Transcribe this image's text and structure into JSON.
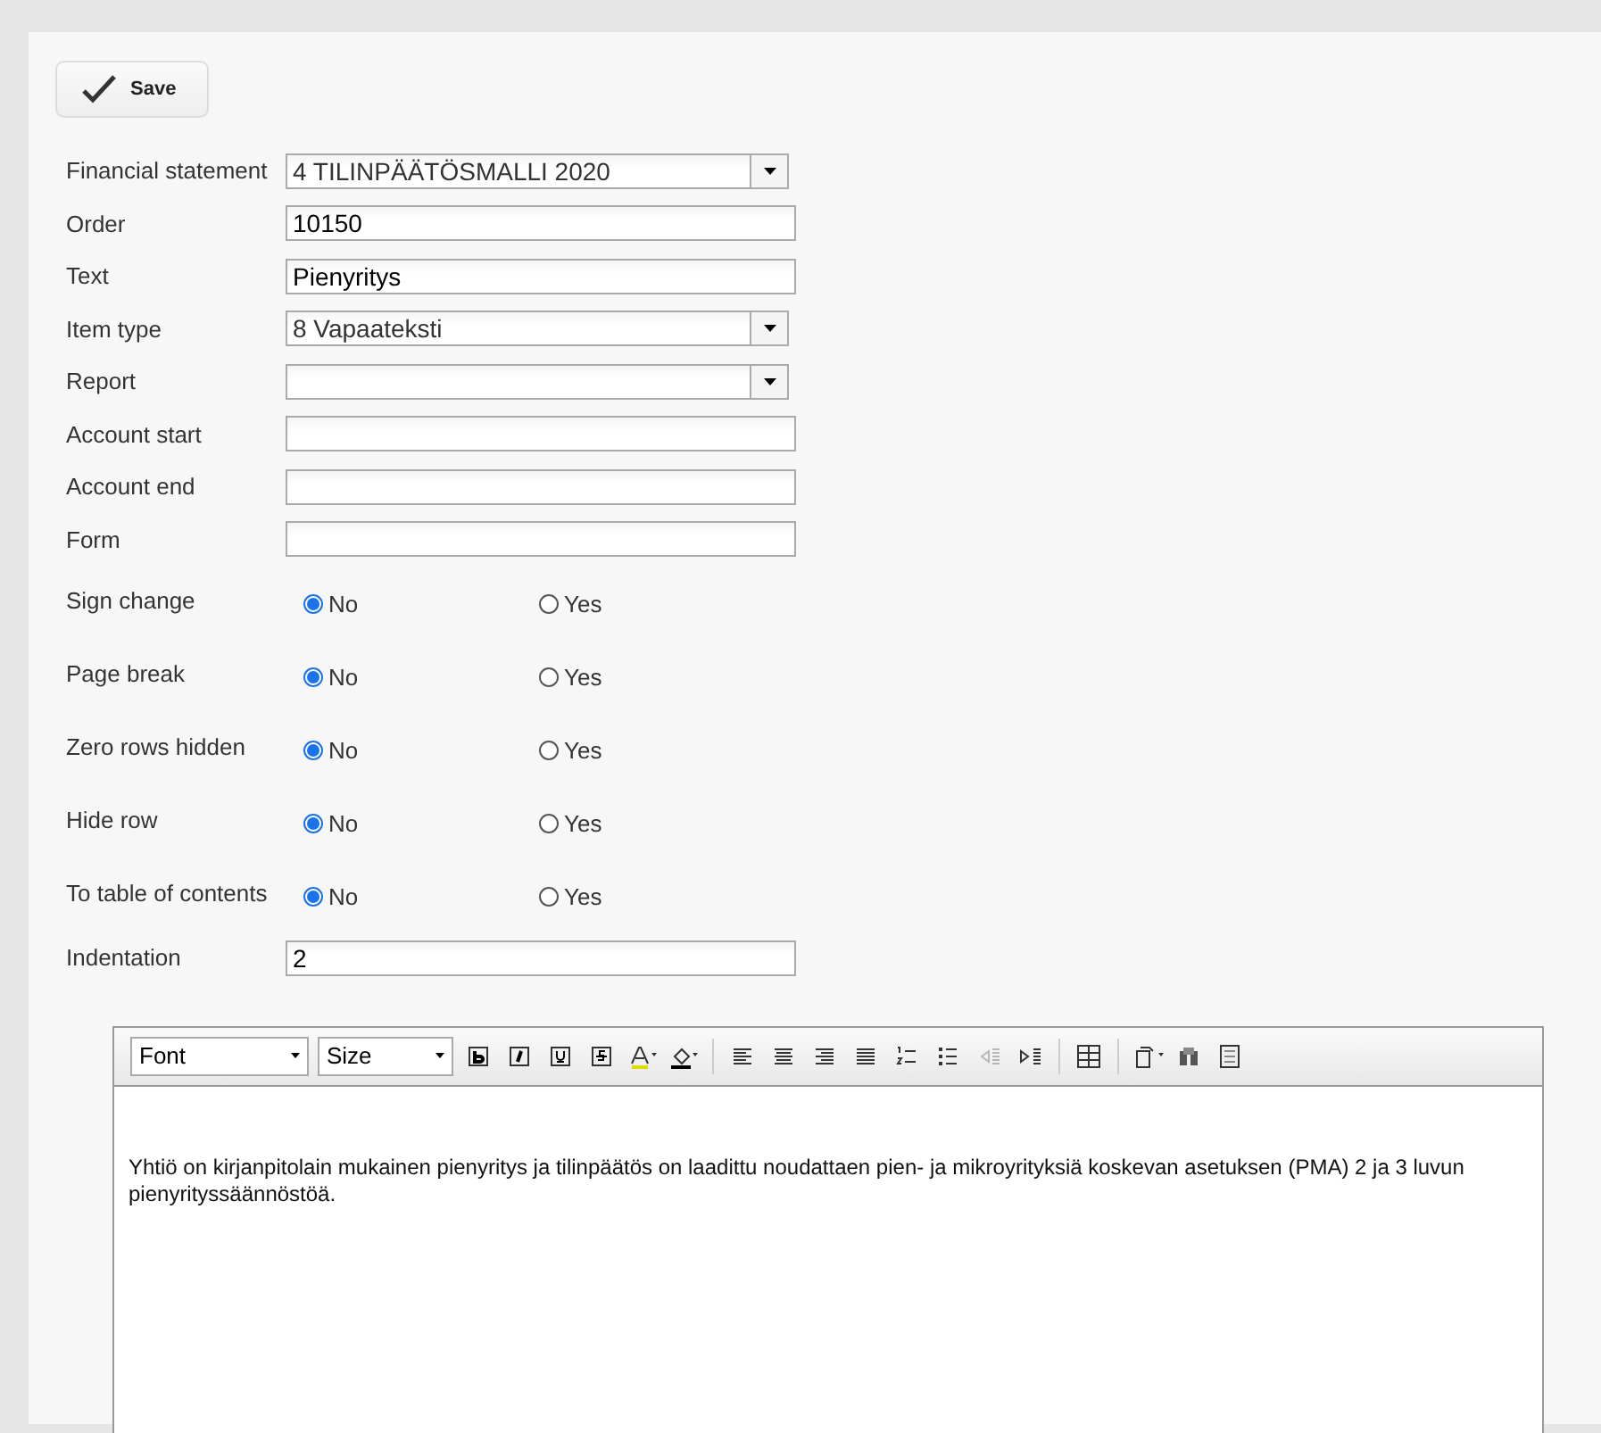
{
  "toolbar": {
    "save_button": "Save"
  },
  "fields": [
    {
      "kind": "select",
      "label": "Financial statement",
      "value": "4 TILINPÄÄTÖSMALLI 2020"
    },
    {
      "kind": "text",
      "label": "Order",
      "value": "10150"
    },
    {
      "kind": "text",
      "label": "Text",
      "value": "Pienyritys"
    },
    {
      "kind": "select",
      "label": "Item type",
      "value": "8 Vapaateksti"
    },
    {
      "kind": "select",
      "label": "Report"
    },
    {
      "kind": "text",
      "label": "Account start"
    },
    {
      "kind": "text",
      "label": "Account end"
    },
    {
      "kind": "text",
      "label": "Form"
    }
  ],
  "radio_groups": [
    {
      "label": "Sign change",
      "options": [
        {
          "label": "No",
          "selected": true
        },
        {
          "label": "Yes",
          "selected": false
        }
      ]
    },
    {
      "label": "Page break",
      "options": [
        {
          "label": "No",
          "selected": true
        },
        {
          "label": "Yes",
          "selected": false
        }
      ]
    },
    {
      "label": "Zero rows hidden",
      "options": [
        {
          "label": "No",
          "selected": true
        },
        {
          "label": "Yes",
          "selected": false
        }
      ]
    },
    {
      "label": "Hide row",
      "options": [
        {
          "label": "No",
          "selected": true
        },
        {
          "label": "Yes",
          "selected": false
        }
      ]
    },
    {
      "label": "To table of contents",
      "options": [
        {
          "label": "No",
          "selected": true
        },
        {
          "label": "Yes",
          "selected": false
        }
      ]
    }
  ],
  "indentation": {
    "label": "Indentation",
    "value": "2"
  },
  "editor": {
    "font_select": "Font",
    "size_select": "Size",
    "toolbar_buttons": [
      {
        "kind": "bold",
        "disabled": false
      },
      {
        "kind": "italic",
        "disabled": false
      },
      {
        "kind": "underline",
        "disabled": false
      },
      {
        "kind": "strike",
        "disabled": false
      },
      {
        "kind": "textcolor",
        "disabled": false
      },
      {
        "kind": "highlight",
        "disabled": false
      },
      {
        "kind": "sep"
      },
      {
        "kind": "alignleft",
        "disabled": false
      },
      {
        "kind": "aligncenter",
        "disabled": false
      },
      {
        "kind": "alignright",
        "disabled": false
      },
      {
        "kind": "justify",
        "disabled": false
      },
      {
        "kind": "ol",
        "disabled": false
      },
      {
        "kind": "ul",
        "disabled": false
      },
      {
        "kind": "outdent",
        "disabled": true
      },
      {
        "kind": "indent",
        "disabled": false
      },
      {
        "kind": "sep"
      },
      {
        "kind": "table",
        "disabled": false
      },
      {
        "kind": "sep"
      },
      {
        "kind": "paste",
        "disabled": false
      },
      {
        "kind": "find",
        "disabled": false
      },
      {
        "kind": "source",
        "disabled": false
      }
    ],
    "content": "Yhtiö on kirjanpitolain mukainen pienyritys ja tilinpäätös on laadittu noudattaen pien- ja mikroyrityksiä koskevan asetuksen (PMA) 2 ja 3 luvun pienyrityssäännöstöä."
  }
}
